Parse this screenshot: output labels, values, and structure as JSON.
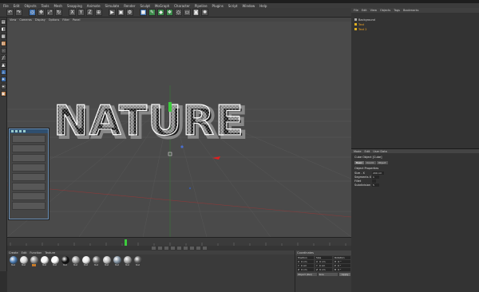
{
  "menubar": {
    "items": [
      "File",
      "Edit",
      "Objects",
      "Tools",
      "Mesh",
      "Snapping",
      "Animate",
      "Simulate",
      "Render",
      "Sculpt",
      "MoGraph",
      "Character",
      "Pipeline",
      "Plugins",
      "Script",
      "Window",
      "Help"
    ]
  },
  "viewport": {
    "menu": [
      "View",
      "Cameras",
      "Display",
      "Options",
      "Filter",
      "Panel"
    ],
    "label": "Perspective",
    "text3d": "NATURE"
  },
  "materials": {
    "menu": [
      "Create",
      "Edit",
      "Function",
      "Texture"
    ],
    "items": [
      {
        "label": "Mat",
        "color": "#4a7ab0"
      },
      {
        "label": "Mat",
        "color": "#d8d8d8"
      },
      {
        "label": "Mat",
        "color": "#8a8a8a",
        "selected": true
      },
      {
        "label": "Mat",
        "color": "#f2f2f2"
      },
      {
        "label": "Mat",
        "color": "#fafafa"
      },
      {
        "label": "Mat",
        "color": "#111111"
      },
      {
        "label": "Mat",
        "color": "#9a9a9a"
      },
      {
        "label": "Mat",
        "color": "#e8e8e8"
      },
      {
        "label": "Mat",
        "color": "#6a6a6a"
      },
      {
        "label": "Mat",
        "color": "#c0c0c0"
      },
      {
        "label": "Mat",
        "color": "#7f8f9f"
      },
      {
        "label": "Mat",
        "color": "#a0a0a0"
      },
      {
        "label": "Mat",
        "color": "#5a5a5a"
      }
    ]
  },
  "coordinates": {
    "title": "Coordinates",
    "headers": [
      "Position",
      "Size",
      "Rotation"
    ],
    "rows": [
      [
        "X",
        "0 cm",
        "X",
        "0 cm",
        "H",
        "0 °"
      ],
      [
        "Y",
        "0 cm",
        "Y",
        "0 cm",
        "P",
        "0 °"
      ],
      [
        "Z",
        "0 cm",
        "Z",
        "0 cm",
        "B",
        "0 °"
      ]
    ],
    "mode": "Object (Rel)",
    "size_mode": "Size",
    "apply": "Apply"
  },
  "objects": {
    "menu": [
      "File",
      "Edit",
      "View",
      "Objects",
      "Tags",
      "Bookmarks"
    ],
    "items": [
      "Background",
      "Text",
      "Text 2"
    ]
  },
  "attributes": {
    "menu": [
      "Mode",
      "Edit",
      "User Data"
    ],
    "object_label": "Cube Object [Cube]",
    "tabs": [
      "Basic",
      "Coord.",
      "Object"
    ],
    "section": "Object Properties",
    "fields": [
      {
        "label": "Size . X",
        "value": "200 cm"
      },
      {
        "label": "Segments X",
        "value": "1"
      },
      {
        "label": "Fillet",
        "value": ""
      },
      {
        "label": "Subdivision",
        "value": "5"
      }
    ]
  },
  "colors": {
    "accent": "#b86b2a",
    "selection_blue": "#3d6fae",
    "viewport_bg": "#4a4a4a",
    "grid": "#555555"
  }
}
